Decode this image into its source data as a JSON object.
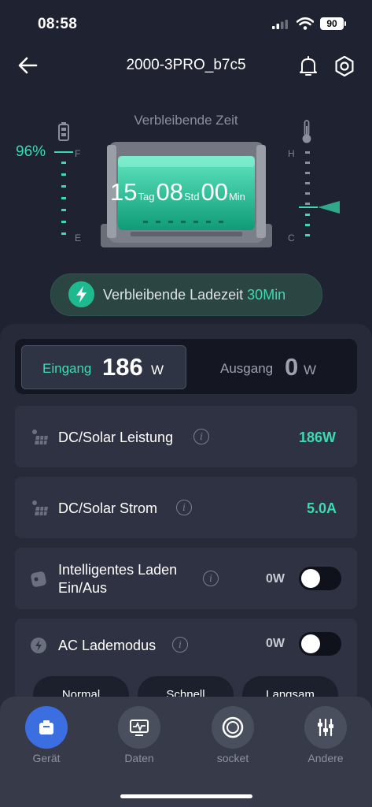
{
  "status": {
    "time": "08:58",
    "battery": "90"
  },
  "header": {
    "title": "2000-3PRO_b7c5"
  },
  "hero": {
    "remaining_label": "Verbleibende Zeit",
    "battery_percent": "96%",
    "gauge_left_top": "F",
    "gauge_left_bottom": "E",
    "gauge_right_top": "H",
    "gauge_right_bottom": "C",
    "days": "15",
    "days_unit": "Tag",
    "hours": "08",
    "hours_unit": "Std",
    "minutes": "00",
    "minutes_unit": "Min"
  },
  "charge_pill": {
    "label": "Verbleibende Ladezeit",
    "value": "30Min"
  },
  "segment": {
    "input_label": "Eingang",
    "input_value": "186",
    "input_unit": "W",
    "output_label": "Ausgang",
    "output_value": "0",
    "output_unit": "W"
  },
  "cards": [
    {
      "label": "DC/Solar Leistung",
      "value": "186W"
    },
    {
      "label": "DC/Solar Strom",
      "value": "5.0A"
    },
    {
      "label_line1": "Intelligentes Laden",
      "label_line2": "Ein/Aus",
      "value": "0W"
    },
    {
      "label": "AC Lademodus",
      "value": "0W"
    }
  ],
  "modes": [
    "Normal",
    "Schnell",
    "Langsam"
  ],
  "tabs": [
    "Gerät",
    "Daten",
    "socket",
    "Andere"
  ],
  "colors": {
    "accent": "#3ddab2",
    "active_tab": "#3b6ee0",
    "background": "#1f2331"
  }
}
